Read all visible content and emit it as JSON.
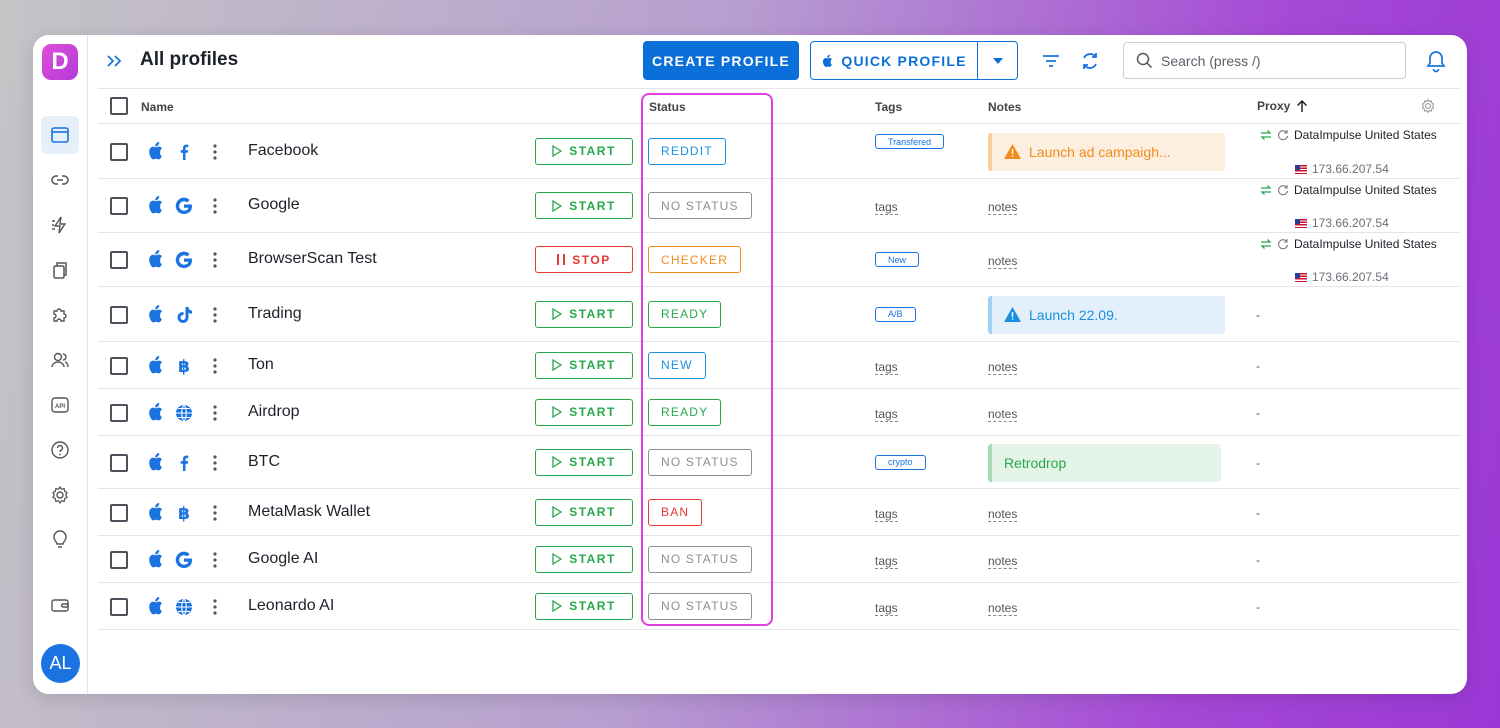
{
  "app": {
    "logo_letter": "D",
    "avatar_initials": "AL"
  },
  "sidebar": {
    "items": [
      {
        "icon": "profiles-icon",
        "active": true
      },
      {
        "icon": "link-icon"
      },
      {
        "icon": "automation-icon"
      },
      {
        "icon": "copy-icon"
      },
      {
        "icon": "extensions-icon"
      },
      {
        "icon": "team-icon"
      },
      {
        "icon": "api-icon"
      },
      {
        "icon": "help-icon"
      },
      {
        "icon": "settings-icon"
      },
      {
        "icon": "idea-icon"
      },
      {
        "icon": "wallet-icon"
      }
    ]
  },
  "header": {
    "title": "All profiles",
    "create_label": "CREATE PROFILE",
    "quick_label": "QUICK PROFILE",
    "search_placeholder": "Search (press /)"
  },
  "table": {
    "columns": {
      "name": "Name",
      "status": "Status",
      "tags": "Tags",
      "notes": "Notes",
      "proxy": "Proxy"
    },
    "tags_placeholder": "tags",
    "notes_placeholder": "notes",
    "rows": [
      {
        "site": "facebook",
        "name": "Facebook",
        "action": "START",
        "status": "REDDIT",
        "status_color": "#1a8fe0",
        "tag": "Transfered",
        "note": "Launch ad campaigh...",
        "note_type": "warning",
        "proxy": "DataImpulse United States",
        "ip": "173.66.207.54"
      },
      {
        "site": "google",
        "name": "Google",
        "action": "START",
        "status": "NO STATUS",
        "status_color": "#8a8f98",
        "tag": "",
        "note": "",
        "proxy": "DataImpulse United States",
        "ip": "173.66.207.54"
      },
      {
        "site": "google",
        "name": "BrowserScan Test",
        "action": "STOP",
        "status": "CHECKER",
        "status_color": "#f08c1c",
        "tag": "New",
        "note": "",
        "proxy": "DataImpulse United States",
        "ip": "173.66.207.54"
      },
      {
        "site": "tiktok",
        "name": "Trading",
        "action": "START",
        "status": "READY",
        "status_color": "#26a84a",
        "tag": "A/B",
        "note": "Launch 22.09.",
        "note_type": "info",
        "proxy": "-",
        "ip": ""
      },
      {
        "site": "bitcoin",
        "name": "Ton",
        "action": "START",
        "status": "NEW",
        "status_color": "#1a8fe0",
        "tag": "",
        "note": "",
        "proxy": "-",
        "ip": ""
      },
      {
        "site": "globe",
        "name": "Airdrop",
        "action": "START",
        "status": "READY",
        "status_color": "#26a84a",
        "tag": "",
        "note": "",
        "proxy": "-",
        "ip": ""
      },
      {
        "site": "facebook",
        "name": "BTC",
        "action": "START",
        "status": "NO STATUS",
        "status_color": "#8a8f98",
        "tag": "crypto",
        "note": "Retrodrop",
        "note_type": "success",
        "proxy": "-",
        "ip": ""
      },
      {
        "site": "bitcoin",
        "name": "MetaMask Wallet",
        "action": "START",
        "status": "BAN",
        "status_color": "#e53935",
        "tag": "",
        "note": "",
        "proxy": "-",
        "ip": ""
      },
      {
        "site": "google",
        "name": "Google AI",
        "action": "START",
        "status": "NO STATUS",
        "status_color": "#8a8f98",
        "tag": "",
        "note": "",
        "proxy": "-",
        "ip": ""
      },
      {
        "site": "globe",
        "name": "Leonardo AI",
        "action": "START",
        "status": "NO STATUS",
        "status_color": "#8a8f98",
        "tag": "",
        "note": "",
        "proxy": "-",
        "ip": ""
      }
    ]
  },
  "colors": {
    "accent": "#0a6fd8",
    "start": "#26a84a",
    "stop": "#e53935",
    "highlight": "#e040e0"
  }
}
